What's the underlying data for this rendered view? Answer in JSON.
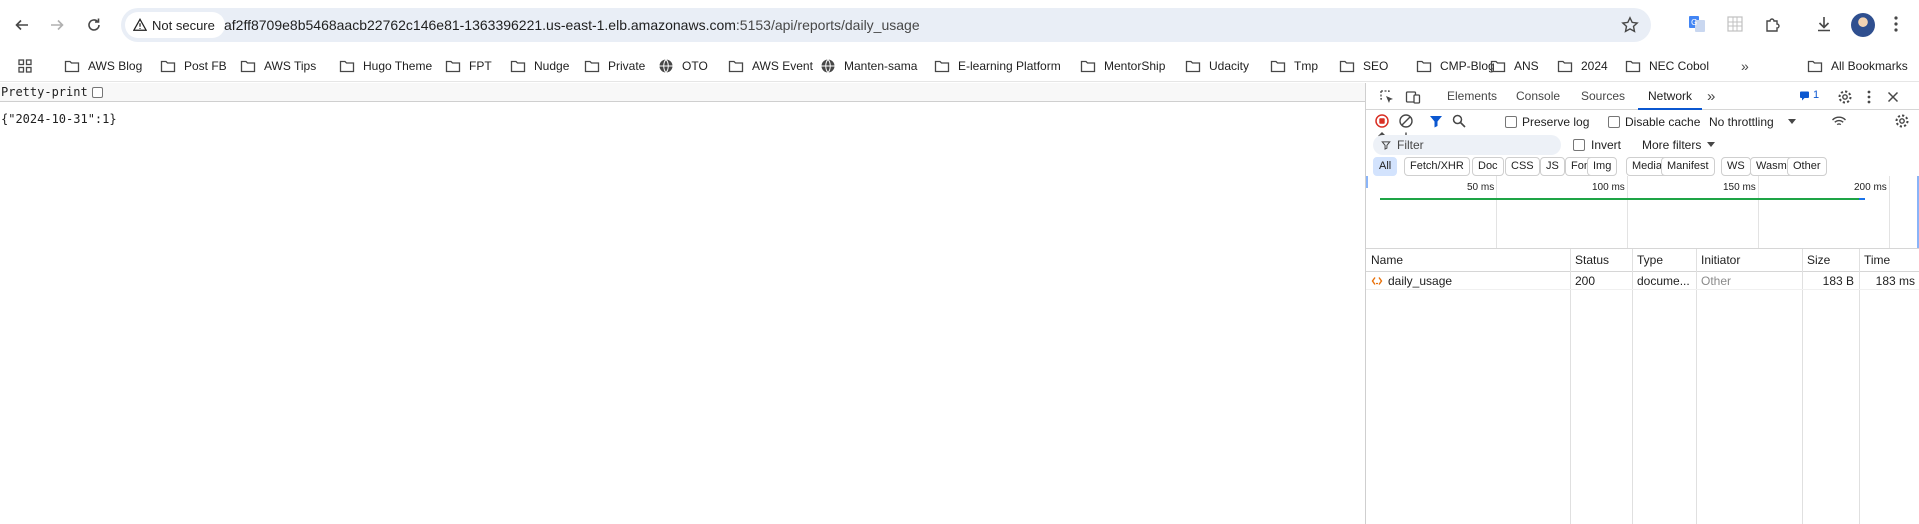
{
  "browser": {
    "security_label": "Not secure",
    "url_host": "af2ff8709e8b5468aacb22762c146e81-1363396221.us-east-1.elb.amazonaws.com",
    "url_rest": ":5153/api/reports/daily_usage"
  },
  "bookmarks": {
    "items": [
      {
        "label": "AWS Blog",
        "icon": "folder-icon"
      },
      {
        "label": "Post FB",
        "icon": "folder-icon"
      },
      {
        "label": "AWS Tips",
        "icon": "folder-icon"
      },
      {
        "label": "Hugo Theme",
        "icon": "folder-icon"
      },
      {
        "label": "FPT",
        "icon": "folder-icon"
      },
      {
        "label": "Nudge",
        "icon": "folder-icon"
      },
      {
        "label": "Private",
        "icon": "folder-icon"
      },
      {
        "label": "OTO",
        "icon": "globe-icon"
      },
      {
        "label": "AWS Event",
        "icon": "folder-icon"
      },
      {
        "label": "Manten-sama",
        "icon": "globe-icon"
      },
      {
        "label": "E-learning Platform",
        "icon": "folder-icon"
      },
      {
        "label": "MentorShip",
        "icon": "folder-icon"
      },
      {
        "label": "Udacity",
        "icon": "folder-icon"
      },
      {
        "label": "Tmp",
        "icon": "folder-icon"
      },
      {
        "label": "SEO",
        "icon": "folder-icon"
      },
      {
        "label": "CMP-Blog",
        "icon": "folder-icon"
      },
      {
        "label": "ANS",
        "icon": "folder-icon"
      },
      {
        "label": "2024",
        "icon": "folder-icon"
      },
      {
        "label": "NEC Cobol",
        "icon": "folder-icon"
      }
    ],
    "overflow": "»",
    "all_bookmarks": "All Bookmarks"
  },
  "page": {
    "pretty_print_label": "Pretty-print",
    "json_body": "{\"2024-10-31\":1}"
  },
  "devtools": {
    "tabs": [
      "Elements",
      "Console",
      "Sources",
      "Network"
    ],
    "active_tab": "Network",
    "more_tabs": "»",
    "issues_count": "1",
    "preserve_log": "Preserve log",
    "disable_cache": "Disable cache",
    "throttling": "No throttling",
    "filter_placeholder": "Filter",
    "invert": "Invert",
    "more_filters": "More filters",
    "type_filters": [
      "All",
      "Fetch/XHR",
      "Doc",
      "CSS",
      "JS",
      "Font",
      "Img",
      "Media",
      "Manifest",
      "WS",
      "Wasm",
      "Other"
    ],
    "active_type_filter": "All",
    "timeline_ticks": [
      "50 ms",
      "100 ms",
      "150 ms",
      "200 ms"
    ],
    "columns": [
      "Name",
      "Status",
      "Type",
      "Initiator",
      "Size",
      "Time"
    ],
    "rows": [
      {
        "name": "daily_usage",
        "status": "200",
        "type": "docume...",
        "initiator": "Other",
        "size": "183 B",
        "time": "183 ms"
      }
    ],
    "accent_color": "#0b57d0"
  }
}
